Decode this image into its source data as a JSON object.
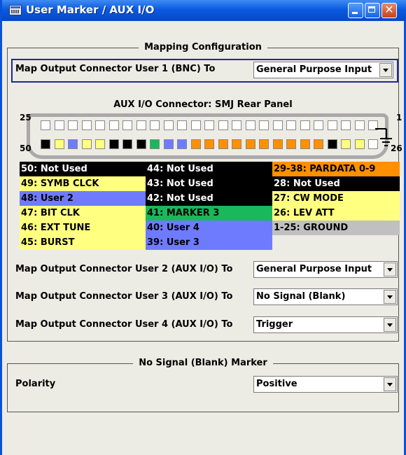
{
  "window": {
    "title": "User Marker / AUX I/O",
    "colors": {
      "titlebar": "#0a5ae0",
      "background": "#ecebe4"
    }
  },
  "mapping": {
    "group_title": "Mapping Configuration",
    "user1": {
      "label": "Map Output Connector User 1 (BNC) To",
      "value": "General Purpose Input"
    },
    "aux_caption": "AUX I/O Connector: SMJ Rear Panel",
    "pin_numbers": {
      "top_left": "25",
      "top_right": "1",
      "bottom_left": "50",
      "bottom_right": "26"
    },
    "pin_colors": {
      "top": [
        "#ffffff",
        "#ffffff",
        "#ffffff",
        "#ffffff",
        "#ffffff",
        "#ffffff",
        "#ffffff",
        "#ffffff",
        "#ffffff",
        "#ffffff",
        "#ffffff",
        "#ffffff",
        "#ffffff",
        "#ffffff",
        "#ffffff",
        "#ffffff",
        "#ffffff",
        "#ffffff",
        "#ffffff",
        "#ffffff",
        "#ffffff",
        "#ffffff",
        "#ffffff",
        "#ffffff",
        "#ffffff"
      ],
      "bottom": [
        "#000000",
        "#ffff80",
        "#6f7bff",
        "#ffff80",
        "#ffff80",
        "#000000",
        "#000000",
        "#000000",
        "#19b85a",
        "#6f7bff",
        "#6f7bff",
        "#ff9000",
        "#ff9000",
        "#ff9000",
        "#ff9000",
        "#ff9000",
        "#ff9000",
        "#ff9000",
        "#ff9000",
        "#ff9000",
        "#ff9000",
        "#000000",
        "#ffff80",
        "#ffff80",
        "#ffffff"
      ]
    },
    "legend": [
      {
        "text": "50: Not Used",
        "color": "#000000"
      },
      {
        "text": "49: SYMB CLCK",
        "color": "#ffff80"
      },
      {
        "text": "48: User 2",
        "color": "#6f7bff"
      },
      {
        "text": "47: BIT CLK",
        "color": "#ffff80"
      },
      {
        "text": "46: EXT TUNE",
        "color": "#ffff80"
      },
      {
        "text": "45: BURST",
        "color": "#ffff80"
      },
      {
        "text": "44: Not Used",
        "color": "#000000"
      },
      {
        "text": "43: Not Used",
        "color": "#000000"
      },
      {
        "text": "42: Not Used",
        "color": "#000000"
      },
      {
        "text": "41: MARKER 3",
        "color": "#19b85a"
      },
      {
        "text": "40: User 4",
        "color": "#6f7bff"
      },
      {
        "text": "39: User 3",
        "color": "#6f7bff"
      },
      {
        "text": "29-38: PARDATA 0-9",
        "color": "#ff9000"
      },
      {
        "text": "28: Not Used",
        "color": "#000000"
      },
      {
        "text": "27: CW MODE",
        "color": "#ffff80"
      },
      {
        "text": "26: LEV ATT",
        "color": "#ffff80"
      },
      {
        "text": "1-25: GROUND",
        "color": "#c0c0c0"
      }
    ],
    "user2": {
      "label": "Map Output Connector User 2 (AUX I/O) To",
      "value": "General Purpose Input"
    },
    "user3": {
      "label": "Map Output Connector User 3 (AUX I/O) To",
      "value": "No Signal (Blank)"
    },
    "user4": {
      "label": "Map Output Connector User 4 (AUX I/O) To",
      "value": "Trigger"
    }
  },
  "blank_marker": {
    "group_title": "No Signal (Blank) Marker",
    "polarity": {
      "label": "Polarity",
      "value": "Positive"
    }
  }
}
